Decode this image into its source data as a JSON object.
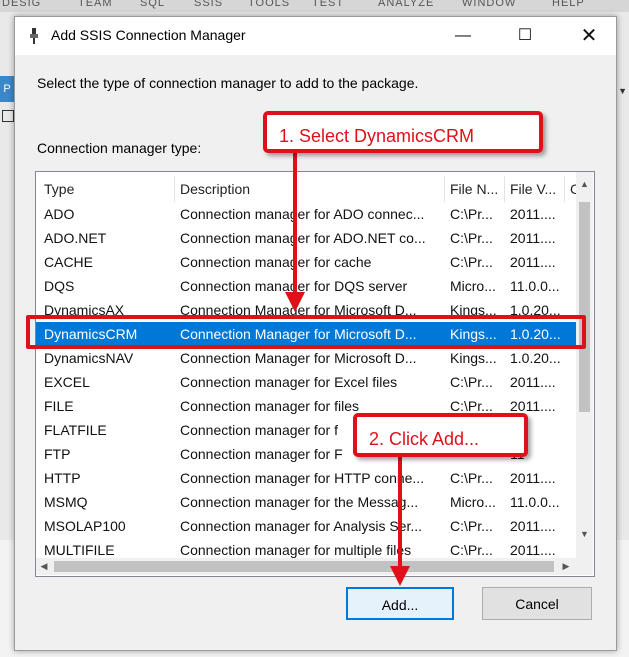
{
  "background_app": {
    "menu_fragments": [
      "DESIG",
      "TEAM",
      "SQL",
      "SSIS",
      "TOOLS",
      "TEST",
      "ANALYZE",
      "WINDOW",
      "HELP"
    ],
    "left_tab": "P"
  },
  "dialog": {
    "title": "Add SSIS Connection Manager",
    "instruction": "Select the type of connection manager to add to the package.",
    "list_label": "Connection manager type:",
    "columns": [
      "Type",
      "Description",
      "File N...",
      "File V...",
      "C"
    ],
    "rows": [
      {
        "type": "ADO",
        "description": "Connection manager for ADO connec...",
        "file_name": "C:\\Pr...",
        "file_version": "2011...."
      },
      {
        "type": "ADO.NET",
        "description": "Connection manager for ADO.NET co...",
        "file_name": "C:\\Pr...",
        "file_version": "2011...."
      },
      {
        "type": "CACHE",
        "description": "Connection manager for cache",
        "file_name": "C:\\Pr...",
        "file_version": "2011...."
      },
      {
        "type": "DQS",
        "description": "Connection manager for DQS server",
        "file_name": "Micro...",
        "file_version": "11.0.0..."
      },
      {
        "type": "DynamicsAX",
        "description": "Connection Manager for Microsoft D...",
        "file_name": "Kings...",
        "file_version": "1.0.20..."
      },
      {
        "type": "DynamicsCRM",
        "description": "Connection Manager for Microsoft D...",
        "file_name": "Kings...",
        "file_version": "1.0.20..."
      },
      {
        "type": "DynamicsNAV",
        "description": "Connection Manager for Microsoft D...",
        "file_name": "Kings...",
        "file_version": "1.0.20..."
      },
      {
        "type": "EXCEL",
        "description": "Connection manager for Excel files",
        "file_name": "C:\\Pr...",
        "file_version": "2011...."
      },
      {
        "type": "FILE",
        "description": "Connection manager for files",
        "file_name": "C:\\Pr...",
        "file_version": "2011...."
      },
      {
        "type": "FLATFILE",
        "description": "Connection manager for f",
        "file_name": "",
        "file_version": "11"
      },
      {
        "type": "FTP",
        "description": "Connection manager for F",
        "file_name": "",
        "file_version": "11"
      },
      {
        "type": "HTTP",
        "description": "Connection manager for HTTP conne...",
        "file_name": "C:\\Pr...",
        "file_version": "2011...."
      },
      {
        "type": "MSMQ",
        "description": "Connection manager for the Messag...",
        "file_name": "Micro...",
        "file_version": "11.0.0..."
      },
      {
        "type": "MSOLAP100",
        "description": "Connection manager for Analysis Ser...",
        "file_name": "C:\\Pr...",
        "file_version": "2011...."
      },
      {
        "type": "MULTIFILE",
        "description": "Connection manager for multiple files",
        "file_name": "C:\\Pr...",
        "file_version": "2011...."
      }
    ],
    "selected_type": "DynamicsCRM",
    "add_label": "Add...",
    "cancel_label": "Cancel"
  },
  "annotations": {
    "step1": "1. Select DynamicsCRM",
    "step2": "2. Click Add..."
  },
  "colors": {
    "selection": "#0078d7",
    "annotation_red": "#e0101a"
  }
}
